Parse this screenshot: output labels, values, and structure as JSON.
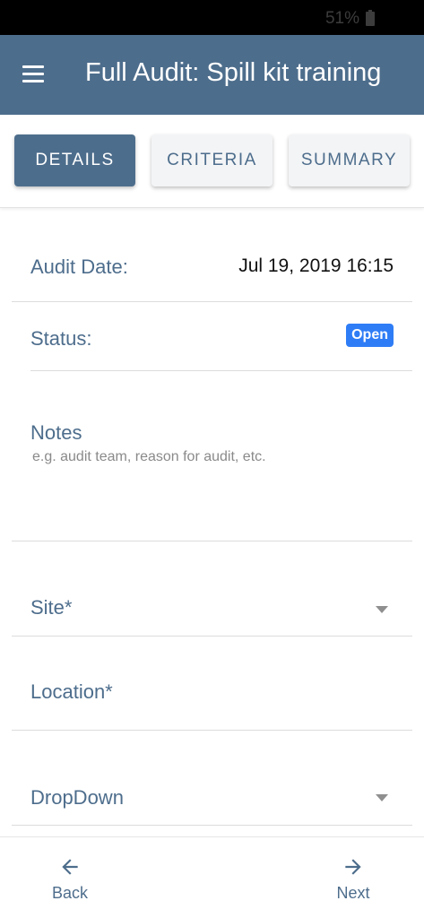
{
  "status_bar": {
    "battery": "51%"
  },
  "header": {
    "title": "Full Audit: Spill kit training",
    "menu_icon": "hamburger-menu-icon"
  },
  "tabs": [
    {
      "label": "DETAILS",
      "active": true
    },
    {
      "label": "CRITERIA",
      "active": false
    },
    {
      "label": "SUMMARY",
      "active": false
    }
  ],
  "form": {
    "audit_date": {
      "label": "Audit Date:",
      "value": "Jul 19, 2019 16:15"
    },
    "status": {
      "label": "Status:",
      "value": "Open"
    },
    "notes": {
      "label": "Notes",
      "placeholder": "e.g. audit team, reason for audit, etc."
    },
    "site": {
      "label": "Site*"
    },
    "location": {
      "label": "Location*"
    },
    "dropdown": {
      "label": "DropDown"
    }
  },
  "bottom_nav": {
    "back": {
      "label": "Back",
      "icon": "arrow-left-icon"
    },
    "next": {
      "label": "Next",
      "icon": "arrow-right-icon"
    }
  },
  "colors": {
    "primary": "#4d6d8c",
    "badge": "#2f7df6",
    "tab_inactive_bg": "#f3f4f6"
  }
}
